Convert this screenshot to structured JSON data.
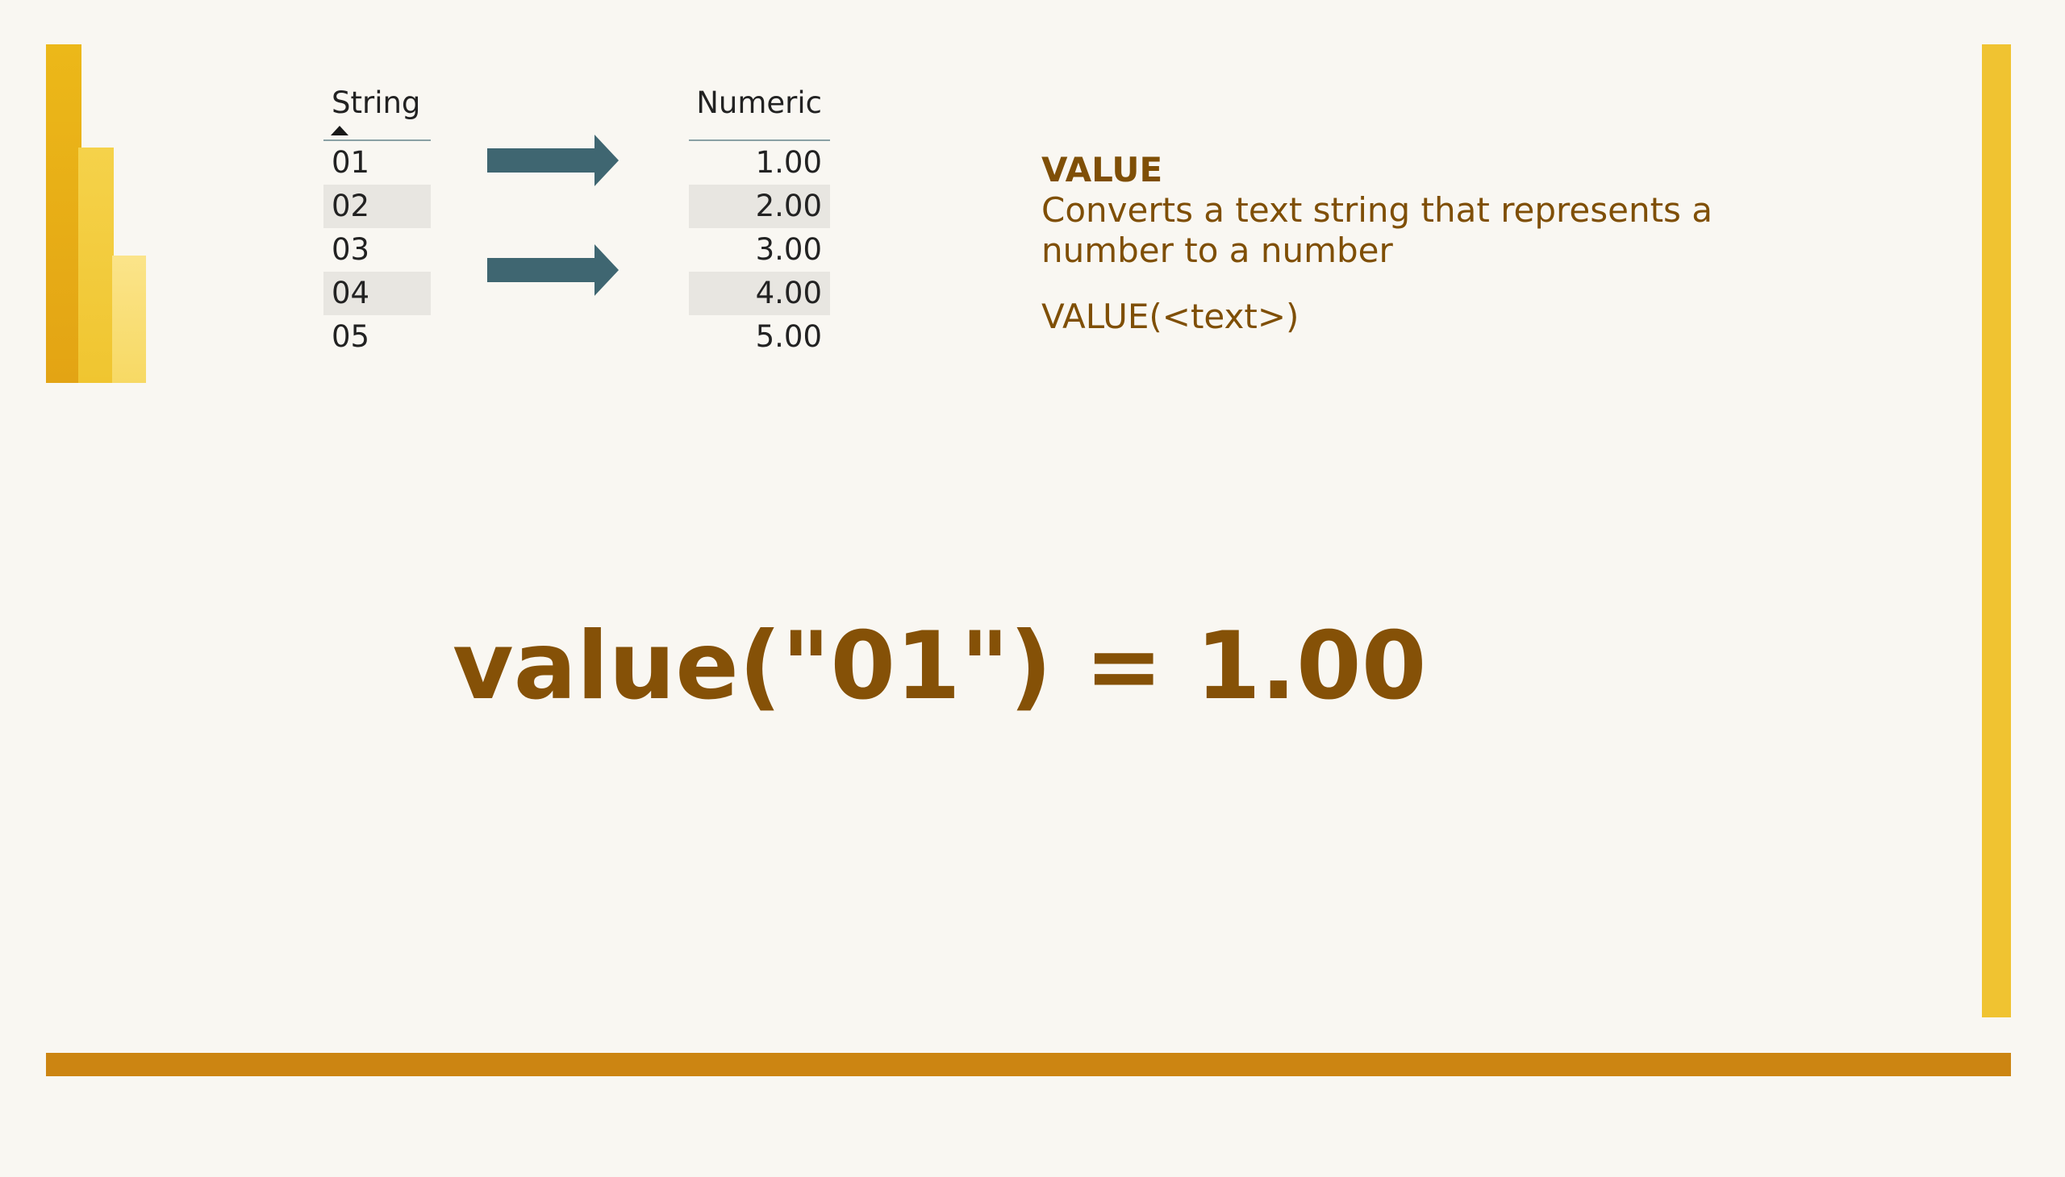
{
  "colors": {
    "background": "#f9f7f2",
    "accent_bar": "#f0c331",
    "bottom_bar": "#cc8512",
    "text_brown": "#855107",
    "arrow": "#3f6671"
  },
  "logo_icon": "power-bi-logo",
  "string_table": {
    "header": "String",
    "sort_icon": "sort-ascending-icon",
    "rows": [
      "01",
      "02",
      "03",
      "04",
      "05"
    ]
  },
  "numeric_table": {
    "header": "Numeric",
    "rows": [
      "1.00",
      "2.00",
      "3.00",
      "4.00",
      "5.00"
    ]
  },
  "arrows": [
    "arrow-right-icon",
    "arrow-right-icon"
  ],
  "description": {
    "name": "VALUE",
    "text": "Converts a text string that represents a number to a number",
    "syntax": "VALUE(<text>)"
  },
  "example": {
    "formula": "value(\"01\") = 1.00"
  }
}
